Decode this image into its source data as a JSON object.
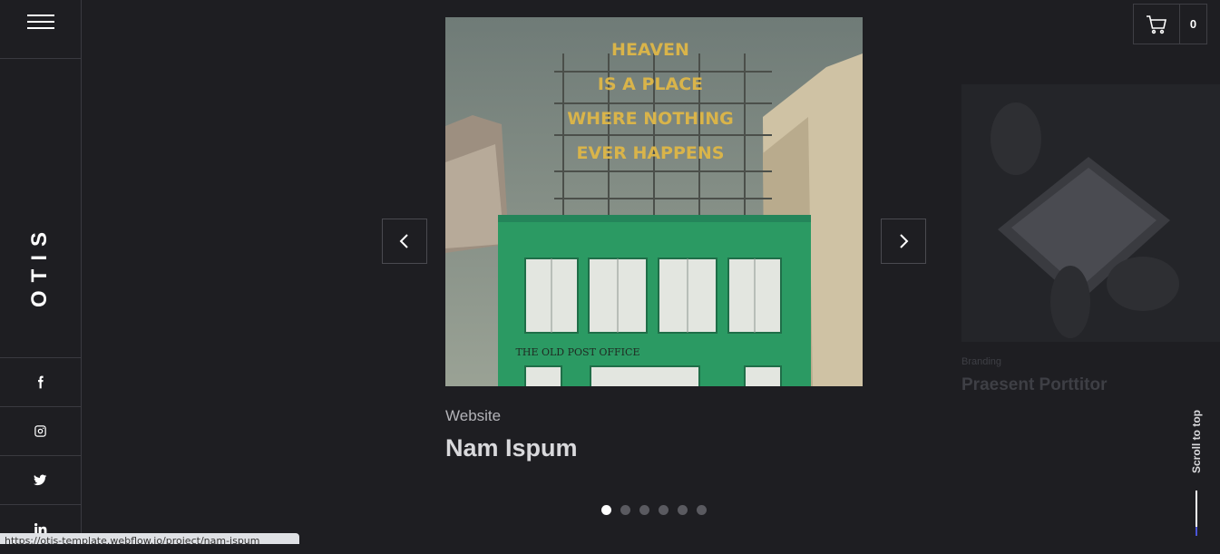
{
  "brand": {
    "name": "OTIS"
  },
  "social": [
    "facebook-icon",
    "instagram-icon",
    "twitter-icon",
    "linkedin-icon"
  ],
  "slider": {
    "current": {
      "category": "Website",
      "title": "Nam Ispum",
      "image_text": {
        "neon": [
          "HEAVEN",
          "IS A PLACE",
          "WHERE NOTHING",
          "EVER HAPPENS"
        ],
        "sign": "THE OLD POST OFFICE"
      }
    },
    "next": {
      "category": "Branding",
      "title": "Praesent Porttitor"
    },
    "dots": 6,
    "active_dot": 0
  },
  "cart": {
    "count": "0"
  },
  "scroll_top": {
    "label": "Scroll to top"
  },
  "status_url": "https://otis-template.webflow.io/project/nam-ispum",
  "colors": {
    "background": "#1e1e22",
    "accent": "#4a55d8",
    "building": "#2b9a63",
    "neon": "#d9b44a"
  }
}
